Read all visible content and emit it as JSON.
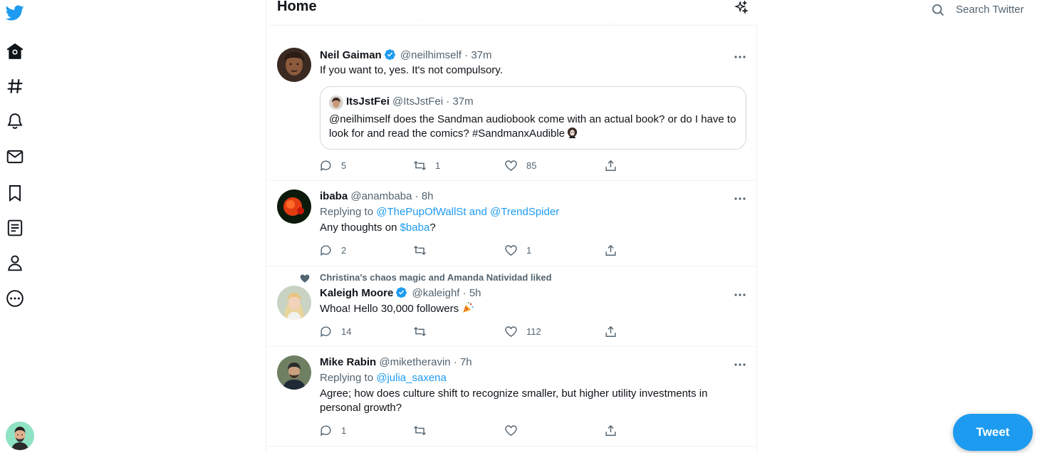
{
  "header": {
    "title": "Home"
  },
  "search": {
    "label": "Search Twitter"
  },
  "compose": {
    "label": "Tweet"
  },
  "colors": {
    "brand": "#1d9bf0",
    "text": "#0f1419",
    "secondary": "#536471",
    "border": "#eff3f4"
  },
  "nav": {
    "items": [
      {
        "icon": "twitter-logo-icon"
      },
      {
        "icon": "home-icon"
      },
      {
        "icon": "explore-hashtag-icon"
      },
      {
        "icon": "notifications-bell-icon"
      },
      {
        "icon": "messages-mail-icon"
      },
      {
        "icon": "bookmark-icon"
      },
      {
        "icon": "lists-icon"
      },
      {
        "icon": "profile-icon"
      },
      {
        "icon": "more-circle-icon"
      }
    ]
  },
  "tweets": [
    {
      "name": "Neil Gaiman",
      "verified": true,
      "handle": "@neilhimself",
      "sep": "·",
      "time": "37m",
      "text": "If you want to, yes. It's not compulsory.",
      "quote": {
        "name": "ItsJstFei",
        "handle": "@ItsJstFei",
        "sep": "·",
        "time": "37m",
        "text": "@neilhimself does the Sandman audiobook come with an actual book? or do I have to look for and read the comics? #SandmanxAudible"
      },
      "replies": "5",
      "retweets": "1",
      "likes": "85"
    },
    {
      "name": "ibaba",
      "handle": "@anambaba",
      "sep": "·",
      "time": "8h",
      "replying_prefix": "Replying to",
      "replying_a": "@ThePupOfWallSt",
      "replying_and": "and",
      "replying_b": "@TrendSpider",
      "text_before": "Any thoughts on",
      "cashtag": "$baba",
      "text_after": "?",
      "replies": "2",
      "retweets": "",
      "likes": "1"
    },
    {
      "social_context": "Christina's chaos magic and Amanda Natividad liked",
      "name": "Kaleigh Moore",
      "verified": true,
      "handle": "@kaleighf",
      "sep": "·",
      "time": "5h",
      "text": "Whoa! Hello 30,000 followers",
      "replies": "14",
      "retweets": "",
      "likes": "112"
    },
    {
      "name": "Mike Rabin",
      "handle": "@miketheravin",
      "sep": "·",
      "time": "7h",
      "replying_prefix": "Replying to",
      "replying_a": "@julia_saxena",
      "text": "Agree; how does culture shift to recognize smaller, but higher utility investments in personal growth?",
      "replies": "1",
      "retweets": "",
      "likes": ""
    }
  ]
}
